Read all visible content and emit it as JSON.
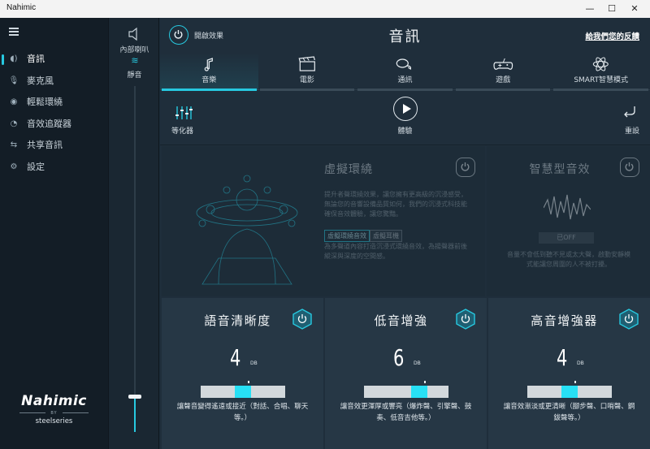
{
  "window": {
    "title": "Nahimic",
    "minimize": "—",
    "maximize": "☐",
    "close": "✕"
  },
  "sidebar": {
    "items": [
      {
        "label": "音訊",
        "icon": "sound-wave-icon",
        "active": true
      },
      {
        "label": "麥克風",
        "icon": "microphone-icon",
        "active": false
      },
      {
        "label": "輕鬆環繞",
        "icon": "surround-icon",
        "active": false
      },
      {
        "label": "音效追蹤器",
        "icon": "tracker-icon",
        "active": false
      },
      {
        "label": "共享音訊",
        "icon": "share-icon",
        "active": false
      },
      {
        "label": "設定",
        "icon": "gear-icon",
        "active": false
      }
    ],
    "logo": {
      "brand": "Nahimic",
      "by": "BY",
      "partner": "steelseries"
    }
  },
  "volume": {
    "device": "內部喇叭",
    "mute_label": "靜音",
    "level": 0.1
  },
  "header": {
    "effects_label": "開啟效果",
    "title": "音訊",
    "feedback": "給我們您的反饋"
  },
  "tabs": [
    {
      "label": "音樂",
      "icon": "music-note-icon",
      "active": true
    },
    {
      "label": "電影",
      "icon": "clapperboard-icon",
      "active": false
    },
    {
      "label": "通訊",
      "icon": "chat-icon",
      "active": false
    },
    {
      "label": "遊戲",
      "icon": "gamepad-icon",
      "active": false
    },
    {
      "label": "SMART智慧模式",
      "icon": "atom-icon",
      "active": false
    }
  ],
  "toolbar": {
    "eq_label": "等化器",
    "play_label": "體驗",
    "reset_label": "重設"
  },
  "virtual_surround": {
    "title": "虛擬環繞",
    "desc": "提升者聲環繞效果，讓您擁有更高級的沉浸感受，無論您的音響設備品質如何，我們的沉浸式科技能確保音效體驗，讓您驚豔。",
    "tab_active": "虛擬環繞音效",
    "tab_other": "虛擬耳機",
    "desc2": "為多聲道內容打造沉浸式環繞音效，為揚聲器前後縱深與深度的空間感。"
  },
  "smart_volume": {
    "title": "智慧型音效",
    "off_label": "已OFF",
    "desc": "音量不會低到聽不見或太大聲，啟動安靜模式能讓您周圍的人不被打擾。"
  },
  "cards": [
    {
      "title": "語音清晰度",
      "value": "4",
      "unit": "DB",
      "level": 0.5,
      "desc": "讓聲音變得遙遠或接近（對話、合唱、聊天等。）"
    },
    {
      "title": "低音增強",
      "value": "6",
      "unit": "DB",
      "level": 0.65,
      "desc": "讓音效更渾厚或響亮（爆炸聲、引擎聲、鼓奏、低音吉他等。）"
    },
    {
      "title": "高音增強器",
      "value": "4",
      "unit": "DB",
      "level": 0.5,
      "desc": "讓音效漸淡或更清晰（腳步聲、口哨聲、鋼鈸聲等。）"
    }
  ],
  "colors": {
    "accent": "#27c9e0",
    "panel": "#263745",
    "sidebar": "#131d26"
  }
}
